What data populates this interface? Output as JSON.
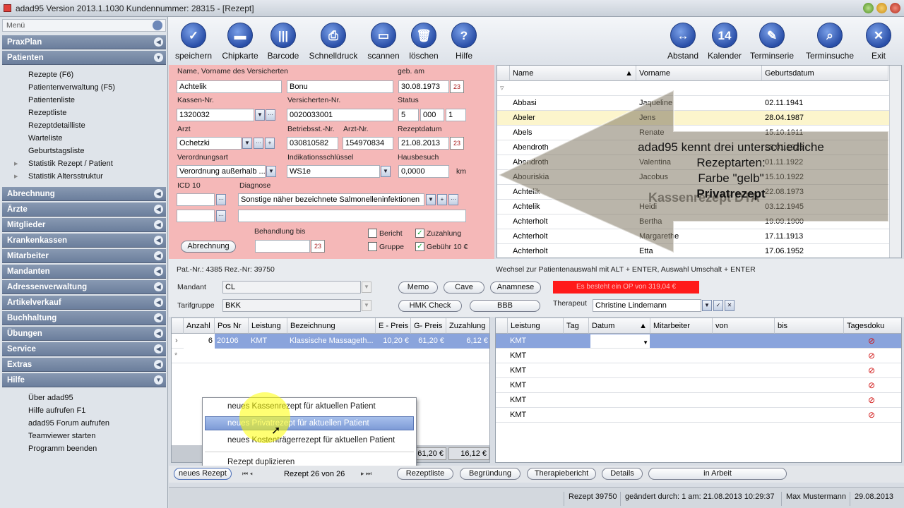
{
  "window": {
    "title": "adad95  Version 2013.1.1030  Kundennummer: 28315 - [Rezept]"
  },
  "menu": {
    "header": "Menü",
    "sections": [
      {
        "label": "PraxPlan"
      },
      {
        "label": "Patienten",
        "items": [
          "Rezepte (F6)",
          "Patientenverwaltung (F5)",
          "Patientenliste",
          "Rezeptliste",
          "Rezeptdetailliste",
          "Warteliste",
          "Geburtstagsliste",
          "Statistik Rezept / Patient",
          "Statistik Altersstruktur"
        ]
      },
      {
        "label": "Abrechnung"
      },
      {
        "label": "Ärzte"
      },
      {
        "label": "Mitglieder"
      },
      {
        "label": "Krankenkassen"
      },
      {
        "label": "Mitarbeiter"
      },
      {
        "label": "Mandanten"
      },
      {
        "label": "Adressenverwaltung"
      },
      {
        "label": "Artikelverkauf"
      },
      {
        "label": "Buchhaltung"
      },
      {
        "label": "Übungen"
      },
      {
        "label": "Service"
      },
      {
        "label": "Extras"
      },
      {
        "label": "Hilfe",
        "items": [
          "Über adad95",
          "Hilfe aufrufen F1",
          "adad95 Forum aufrufen",
          "Teamviewer starten",
          "Programm beenden"
        ]
      }
    ]
  },
  "toolbar": {
    "left": [
      "speichern",
      "Chipkarte",
      "Barcode",
      "Schnelldruck",
      "scannen",
      "löschen",
      "Hilfe"
    ],
    "right": [
      "Abstand",
      "Kalender",
      "Terminserie",
      "Terminsuche",
      "Exit"
    ]
  },
  "form": {
    "name_label": "Name, Vorname des Versicherten",
    "nachname": "Achtelik",
    "vorname": "Bonu",
    "gebam_label": "geb. am",
    "gebam": "30.08.1973",
    "kassennr_label": "Kassen-Nr.",
    "kassennr": "1320032",
    "versnr_label": "Versicherten-Nr.",
    "versnr": "0020033001",
    "status_label": "Status",
    "status1": "5",
    "status2": "000",
    "status3": "1",
    "arzt_label": "Arzt",
    "arzt": "Ochetzki",
    "betrieb_label": "Betriebsst.-Nr.",
    "betrieb": "030810582",
    "arztnr_label": "Arzt-Nr.",
    "arztnr": "154970834",
    "rezeptdatum_label": "Rezeptdatum",
    "rezeptdatum": "21.08.2013",
    "verordnung_label": "Verordnungsart",
    "verordnung": "Verordnung außerhalb ...",
    "indik_label": "Indikationsschlüssel",
    "indik": "WS1e",
    "hausbesuch_label": "Hausbesuch",
    "hausbesuch": "0,0000",
    "km": "km",
    "icd_label": "ICD 10",
    "diagnose_label": "Diagnose",
    "diagnose": "Sonstige näher bezeichnete Salmonelleninfektionen",
    "behandlung_label": "Behandlung bis",
    "abrechnung_btn": "Abrechnung",
    "bericht": "Bericht",
    "gruppe": "Gruppe",
    "zuzahlung": "Zuzahlung",
    "gebuehr": "Gebühr  10 €",
    "cal_day": "23"
  },
  "grid1": {
    "headers": [
      "Name",
      "Vorname",
      "Geburtsdatum"
    ],
    "rows": [
      [
        "Abbasi",
        "Jaqueline",
        "02.11.1941"
      ],
      [
        "Abeler",
        "Jens",
        "28.04.1987"
      ],
      [
        "Abels",
        "Renate",
        "15.10.1911"
      ],
      [
        "Abendroth",
        "",
        "28.01.1925"
      ],
      [
        "Abendroth",
        "Valentina",
        "01.11.1922"
      ],
      [
        "Abouriskia",
        "Jacobus",
        "15.10.1922"
      ],
      [
        "Achtelik",
        "",
        "22.08.1973"
      ],
      [
        "Achtelik",
        "Heidi",
        "03.12.1945"
      ],
      [
        "Achterholt",
        "Bertha",
        "19.09.1900"
      ],
      [
        "Achterholt",
        "Margarethe",
        "17.11.1913"
      ],
      [
        "Achterholt",
        "Etta",
        "17.06.1952"
      ]
    ]
  },
  "callout": {
    "line1": "adad95 kennt drei unterschiedliche",
    "line2": "Rezeptarten:",
    "line3": "Farbe \"gelb\"",
    "line4": "Privatrezept",
    "ghost": "Kassenrezept DTA"
  },
  "mid": {
    "patnr": "Pat.-Nr.: 4385  Rez.-Nr: 39750",
    "hint": "Wechsel zur Patientenauswahl mit ALT + ENTER, Auswahl Umschalt + ENTER",
    "mandant_label": "Mandant",
    "mandant": "CL",
    "tarif_label": "Tarifgruppe",
    "tarif": "BKK",
    "memo": "Memo",
    "cave": "Cave",
    "anamnese": "Anamnese",
    "hmk": "HMK Check",
    "bbb": "BBB",
    "op": "Es besteht ein OP von 319,04 €",
    "therapeut_label": "Therapeut",
    "therapeut": "Christine Lindemann"
  },
  "grid2": {
    "headers": [
      "Anzahl",
      "Pos Nr",
      "Leistung",
      "Bezeichnung",
      "E - Preis",
      "G- Preis",
      "Zuzahlung"
    ],
    "row": [
      "6",
      "20106",
      "KMT",
      "Klassische Massageth...",
      "10,20 €",
      "61,20 €",
      "6,12 €"
    ],
    "sum_g": "61,20 €",
    "sum_z": "16,12 €"
  },
  "grid3": {
    "headers": [
      "Leistung",
      "Tag",
      "Datum",
      "Mitarbeiter",
      "von",
      "bis",
      "Tagesdoku"
    ],
    "rows": [
      "KMT",
      "KMT",
      "KMT",
      "KMT",
      "KMT",
      "KMT"
    ]
  },
  "context_menu": {
    "items": [
      "neues Kassenrezept für aktuellen Patient",
      "neues Privatrezept für aktuellen Patient",
      "neues Kostenträgerrezept für aktuellen Patient",
      "Rezept duplizieren"
    ]
  },
  "bottom": {
    "neues_rezept": "neues Rezept",
    "nav": "Rezept 26 von 26",
    "rezeptliste": "Rezeptliste",
    "begruendung": "Begründung",
    "therapiebericht": "Therapiebericht",
    "details": "Details",
    "inarbeit": "in Arbeit"
  },
  "status": {
    "rezept": "Rezept 39750",
    "geaendert": "geändert durch: 1 am: 21.08.2013 10:29:37",
    "user": "Max Mustermann",
    "date": "29.08.2013"
  },
  "colors": {
    "form_bg": "#f5b8b8",
    "menu_header": "#7385a3",
    "highlight_row": "#fcf5cc",
    "selected": "#8aa4dc",
    "op_red": "#ff1a1a"
  }
}
